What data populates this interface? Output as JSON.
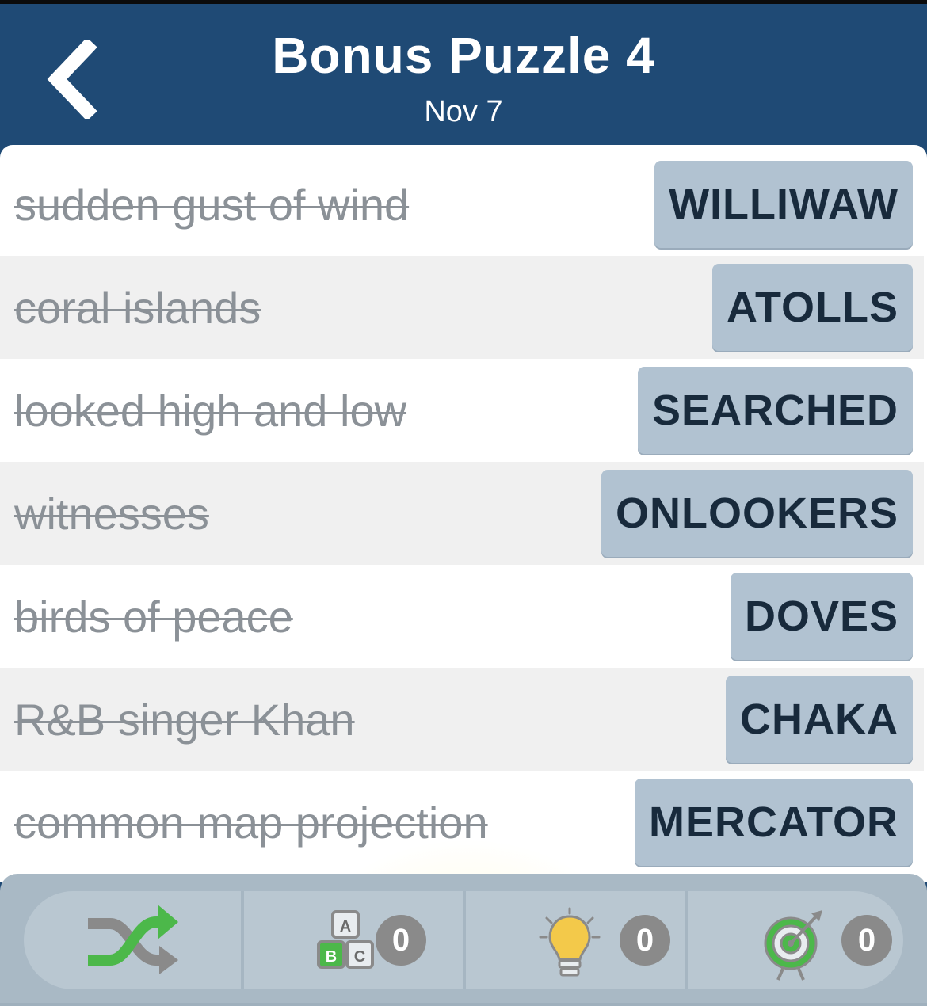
{
  "header": {
    "title": "Bonus Puzzle 4",
    "date": "Nov 7",
    "background_color": "#1f4a75"
  },
  "clues": [
    {
      "clue": "sudden gust of wind",
      "answer": "WILLIWAW"
    },
    {
      "clue": "coral islands",
      "answer": "ATOLLS"
    },
    {
      "clue": "looked high and low",
      "answer": "SEARCHED"
    },
    {
      "clue": "witnesses",
      "answer": "ONLOOKERS"
    },
    {
      "clue": "birds of peace",
      "answer": "DOVES"
    },
    {
      "clue": "R&B singer Khan",
      "answer": "CHAKA"
    },
    {
      "clue": "common map projection",
      "answer": "MERCATOR"
    }
  ],
  "toolbar": {
    "shuffle": {
      "icon": "shuffle-icon"
    },
    "letters": {
      "icon": "abc-blocks-icon",
      "count": "0",
      "block_labels": [
        "A",
        "B",
        "C"
      ]
    },
    "hint": {
      "icon": "lightbulb-icon",
      "count": "0"
    },
    "target": {
      "icon": "target-icon",
      "count": "0"
    }
  },
  "colors": {
    "answer_tile": "#b1c2d1",
    "answer_text": "#182a3c",
    "solved_clue_text": "#8b9197",
    "shuffle_green": "#4cb84a",
    "badge": "#8a8a8a"
  }
}
